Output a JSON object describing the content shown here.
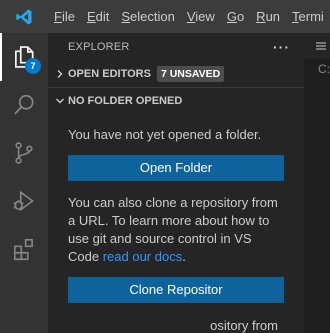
{
  "menu": {
    "items": [
      {
        "mnemonic": "F",
        "rest": "ile"
      },
      {
        "mnemonic": "E",
        "rest": "dit"
      },
      {
        "mnemonic": "S",
        "rest": "election"
      },
      {
        "mnemonic": "V",
        "rest": "iew"
      },
      {
        "mnemonic": "G",
        "rest": "o"
      },
      {
        "mnemonic": "R",
        "rest": "un"
      },
      {
        "mnemonic": "T",
        "rest": "ermi"
      }
    ]
  },
  "activity_bar": {
    "icons": [
      "explorer-icon",
      "search-icon",
      "source-control-icon",
      "run-debug-icon",
      "extensions-icon"
    ],
    "explorer_badge": "7"
  },
  "explorer": {
    "title": "EXPLORER",
    "more_actions": "···",
    "open_editors": {
      "label": "OPEN EDITORS",
      "badge": "7 UNSAVED"
    },
    "no_folder": {
      "label": "NO FOLDER OPENED"
    },
    "message_1": "You have not yet opened a folder.",
    "open_folder_button": "Open Folder",
    "message_2_prefix": "You can also clone a repository from a URL. To learn more about how to use git and source control in VS Code ",
    "message_2_link": "read our docs",
    "message_2_suffix": ".",
    "clone_button": "Clone Repositor",
    "partial_text": "ository from"
  },
  "editor": {
    "tab_fragment": "C:"
  },
  "colors": {
    "titlebar": "#3c3c3c",
    "activity_bar": "#333333",
    "sidebar": "#252526",
    "button": "#0e639c",
    "badge": "#007acc",
    "link": "#3794ff"
  }
}
